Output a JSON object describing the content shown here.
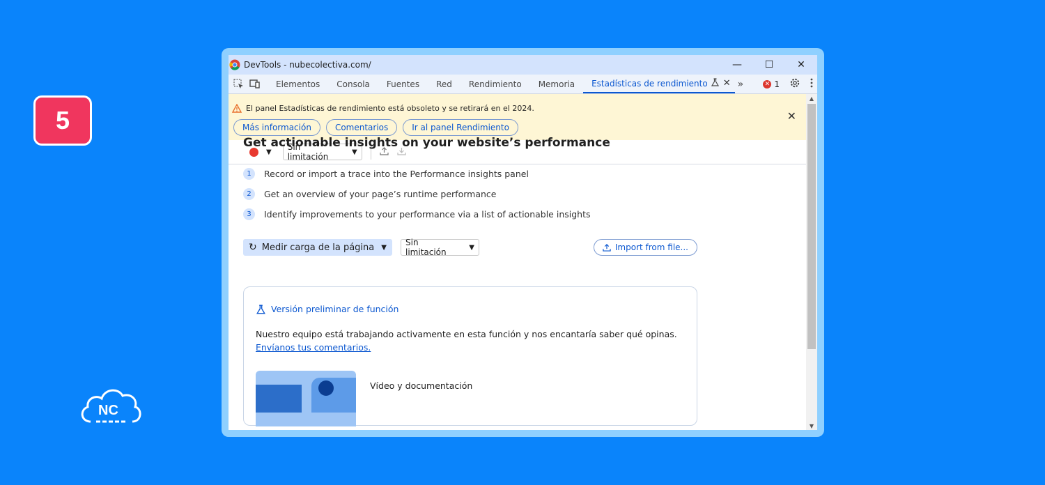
{
  "badge": {
    "number": "5"
  },
  "logo": {
    "text": "NC"
  },
  "window": {
    "title": "DevTools - nubecolectiva.com/",
    "controls": {
      "minimize": "—",
      "maximize": "☐",
      "close": "✕"
    }
  },
  "tabs": {
    "items": [
      {
        "label": "Elementos"
      },
      {
        "label": "Consola"
      },
      {
        "label": "Fuentes"
      },
      {
        "label": "Red"
      },
      {
        "label": "Rendimiento"
      },
      {
        "label": "Memoria"
      },
      {
        "label": "Estadísticas de rendimiento"
      }
    ],
    "more": "»",
    "error_count": "1",
    "colors": {
      "active": "#0b57d0",
      "error": "#dc362e"
    }
  },
  "warning": {
    "message": "El panel Estadísticas de rendimiento está obsoleto y se retirará en el 2024.",
    "buttons": {
      "more_info": "Más información",
      "comments": "Comentarios",
      "go_to_panel": "Ir al panel Rendimiento"
    },
    "close": "✕"
  },
  "toolbar": {
    "throttle": "Sin limitación",
    "icons": [
      "record-icon",
      "upload-icon",
      "download-icon"
    ]
  },
  "main": {
    "heading": "Get actionable insights on your website’s performance",
    "steps": [
      {
        "num": "1",
        "text": "Record or import a trace into the Performance insights panel"
      },
      {
        "num": "2",
        "text": "Get an overview of your page’s runtime performance"
      },
      {
        "num": "3",
        "text": "Identify improvements to your performance via a list of actionable insights"
      }
    ],
    "measure_label": "Medir carga de la página",
    "throttle": "Sin limitación",
    "import_label": "Import from file..."
  },
  "card": {
    "feature_label": "Versión preliminar de función",
    "desc_text": "Nuestro equipo está trabajando activamente en esta función y nos encantaría saber qué opinas. ",
    "desc_link": "Envíanos tus comentarios.",
    "video_label": "Vídeo y documentación"
  }
}
